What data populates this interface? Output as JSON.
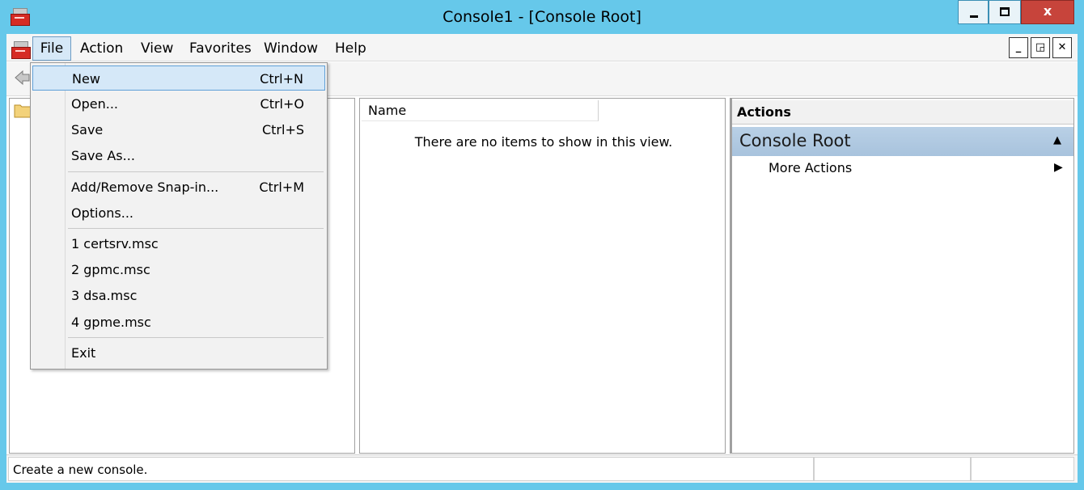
{
  "window": {
    "title": "Console1 - [Console Root]",
    "close_glyph": "x"
  },
  "menubar": {
    "items": [
      "File",
      "Action",
      "View",
      "Favorites",
      "Window",
      "Help"
    ]
  },
  "file_menu": {
    "items": [
      {
        "label": "New",
        "shortcut": "Ctrl+N"
      },
      {
        "label": "Open...",
        "shortcut": "Ctrl+O"
      },
      {
        "label": "Save",
        "shortcut": "Ctrl+S"
      },
      {
        "label": "Save As...",
        "shortcut": ""
      },
      {
        "label": "Add/Remove Snap-in...",
        "shortcut": "Ctrl+M"
      },
      {
        "label": "Options...",
        "shortcut": ""
      },
      {
        "label": "1 certsrv.msc",
        "shortcut": ""
      },
      {
        "label": "2 gpmc.msc",
        "shortcut": ""
      },
      {
        "label": "3 dsa.msc",
        "shortcut": ""
      },
      {
        "label": "4 gpme.msc",
        "shortcut": ""
      },
      {
        "label": "Exit",
        "shortcut": ""
      }
    ]
  },
  "list": {
    "column_name": "Name",
    "empty_message": "There are no items to show in this view."
  },
  "actions": {
    "header": "Actions",
    "section_title": "Console Root",
    "more_actions": "More Actions"
  },
  "status": {
    "text": "Create a new console."
  },
  "colors": {
    "title_bar": "#66c8ea",
    "close_button": "#c7443b",
    "selection": "#d5e8f8",
    "actions_section": "#b9d0e6"
  },
  "icons": [
    "app-icon",
    "minimize-icon",
    "maximize-icon",
    "close-icon",
    "back-arrow-icon",
    "folder-icon",
    "collapse-up-icon",
    "expand-right-icon"
  ]
}
